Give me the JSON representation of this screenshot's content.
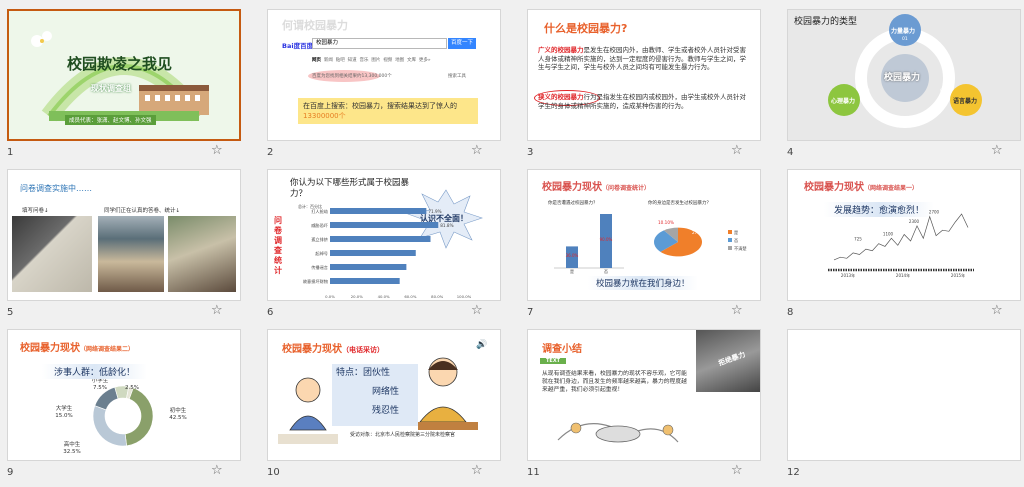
{
  "slides": [
    {
      "number": "1",
      "title": "校园欺凌之我见",
      "subtitle": "现状调查组",
      "members": "成员代表：张潇、赵文博、孙文强"
    },
    {
      "number": "2",
      "title": "何谓校园暴力",
      "search_brand": "Bai度百度",
      "search_query": "校园暴力",
      "search_button": "百度一下",
      "search_tabs": [
        "网页",
        "新闻",
        "贴吧",
        "知道",
        "音乐",
        "图片",
        "视频",
        "地图",
        "文库",
        "更多»"
      ],
      "search_result": "百度为您找到相关结果约13,300,000个",
      "search_tools": "搜索工具",
      "caption_pre": "在百度上搜索：校园暴力，搜索结果达到了惊人的",
      "caption_count": "13300000个"
    },
    {
      "number": "3",
      "title": "什么是校园暴力?",
      "broad_term": "广义的校园暴力",
      "broad_text": "是发生在校园内外，由教师、学生或者校外人员针对受害人身体或精神所实施的，达到一定程度的侵害行为。教师与学生之间，学生与学生之间，学生与校外人员之间均有可能发生暴力行为。",
      "narrow_term": "狭义的校园暴力",
      "narrow_text": "行为是指发生在校园内或校园外，由学生或校外人员针对学生的身体或精神所实施的，造成某种伤害的行为。"
    },
    {
      "number": "4",
      "title": "校园暴力的类型",
      "center": "校园暴力",
      "items": [
        {
          "label": "力量暴力",
          "num": "01"
        },
        {
          "label": "语言暴力",
          "num": "02"
        },
        {
          "label": "心理暴力",
          "num": "03"
        }
      ]
    },
    {
      "number": "5",
      "title": "问卷调查实施中……",
      "label_left": "填写问卷↓",
      "label_right": "同学们正在认真的答卷、统计↓"
    },
    {
      "number": "6",
      "question": "你认为以下哪些形式属于校园暴力？",
      "side_label": "问卷调查统计",
      "bubble": "认识不全面！",
      "legend": "总计：百分比",
      "axis_ticks": [
        "0.0%",
        "20.0%",
        "40.0%",
        "60.0%",
        "80.0%",
        "100.0%"
      ]
    },
    {
      "number": "7",
      "title": "校园暴力现状",
      "title_note": "（问卷调查统计）",
      "q1": "你是否遭遇过校园暴力？",
      "q2": "你的身边是否发生过校园暴力？",
      "bar_labels": [
        "36.0%",
        "90.0%"
      ],
      "pie_labels": [
        "10.10%",
        "27.10%",
        "63.50%"
      ],
      "legend": [
        "是",
        "否",
        "不清楚"
      ],
      "banner": "校园暴力就在我们身边！"
    },
    {
      "number": "8",
      "title": "校园暴力现状",
      "title_note": "（网络调查结果一）",
      "trend": "发展趋势：愈演愈烈！",
      "years": [
        "2013年",
        "2014年",
        "2015年"
      ],
      "peak_labels": [
        "725",
        "1100",
        "2300",
        "2700"
      ]
    },
    {
      "number": "9",
      "title": "校园暴力现状",
      "title_note": "（网络调查结果二）",
      "headline": "涉事人群：低龄化！",
      "segments": [
        {
          "name": "初中生",
          "value": "42.5%",
          "v": 42.5
        },
        {
          "name": "高中生",
          "value": "32.5%",
          "v": 32.5
        },
        {
          "name": "大学生",
          "value": "15.0%",
          "v": 15.0
        },
        {
          "name": "小学生",
          "value": "7.5%",
          "v": 7.5
        },
        {
          "name": "",
          "value": "2.5%",
          "v": 2.5
        }
      ]
    },
    {
      "number": "10",
      "title": "校园暴力现状",
      "title_note": "（电话采访）",
      "features": [
        "特点：团伙性",
        "网络性",
        "残忍性"
      ],
      "interviewee": "受访对象：北京市人民检察院第三分院未检察官"
    },
    {
      "number": "11",
      "title": "调查小结",
      "tag": "TEXT",
      "body": "从现有调查结果来看，校园暴力的现状不容乐观，它可能就在我们身边，而且发生的频率越来越高，暴力的程度越来越严重，我们必须引起重视！",
      "poster_text": "拒绝暴力"
    },
    {
      "number": "12"
    }
  ],
  "chart_data": [
    {
      "type": "bar",
      "orientation": "horizontal",
      "title": "你认为以下哪些形式属于校园暴力？",
      "categories": [
        "打人抢劫",
        "威胁恐吓",
        "孤立排挤",
        "起绰号",
        "传播谣言",
        "故意损坏财物"
      ],
      "values": [
        71.9,
        80.8,
        75.0,
        64.0,
        57.0,
        52.0
      ],
      "data_labels": [
        "71.9%",
        "81.8%",
        "",
        "",
        "",
        ""
      ],
      "xlim": [
        0,
        100
      ]
    },
    {
      "type": "bar",
      "title": "你是否遭遇过校园暴力？",
      "categories": [
        "是",
        "否"
      ],
      "values": [
        36.0,
        90.0
      ]
    },
    {
      "type": "pie",
      "title": "你的身边是否发生过校园暴力？",
      "categories": [
        "是",
        "否",
        "不清楚"
      ],
      "values": [
        63.5,
        27.1,
        10.1
      ]
    },
    {
      "type": "line",
      "title": "发展趋势：愈演愈烈！",
      "x": [
        "2013年",
        "2014年",
        "2015年"
      ],
      "labeled_values": [
        725,
        1100,
        2300,
        2700
      ]
    },
    {
      "type": "pie",
      "title": "涉事人群：低龄化！",
      "categories": [
        "初中生",
        "高中生",
        "大学生",
        "小学生",
        ""
      ],
      "values": [
        42.5,
        32.5,
        15.0,
        7.5,
        2.5
      ]
    }
  ],
  "colors": {
    "selected_border": "#c55a11",
    "title_red": "#e0282b",
    "title_orange": "#e8612c",
    "bar_blue": "#4f81bd",
    "caption_yellow": "#fde68a"
  },
  "icons": {
    "favorite": "star-outline-icon",
    "speaker": "speaker-icon"
  }
}
